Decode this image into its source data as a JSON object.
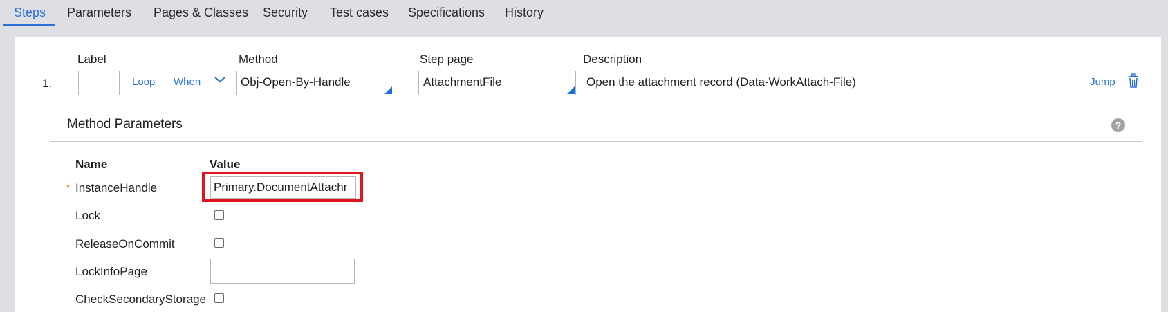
{
  "tabs": [
    {
      "label": "Steps",
      "active": true
    },
    {
      "label": "Parameters"
    },
    {
      "label": "Pages & Classes"
    },
    {
      "label": "Security"
    },
    {
      "label": "Test cases"
    },
    {
      "label": "Specifications"
    },
    {
      "label": "History"
    }
  ],
  "step": {
    "number": "1.",
    "headers": {
      "label": "Label",
      "method": "Method",
      "step_page": "Step page",
      "description": "Description"
    },
    "label_value": "",
    "loop_link": "Loop",
    "when_link": "When",
    "method_value": "Obj-Open-By-Handle",
    "step_page_value": "AttachmentFile",
    "description_value": "Open the attachment record (Data-WorkAttach-File)",
    "jump_link": "Jump"
  },
  "method_parameters": {
    "title": "Method Parameters",
    "help": "?",
    "name_header": "Name",
    "value_header": "Value",
    "required_marker": "*",
    "params": [
      {
        "name": "InstanceHandle",
        "value": "Primary.DocumentAttachr",
        "required": true,
        "type": "text",
        "highlighted": true
      },
      {
        "name": "Lock",
        "type": "checkbox",
        "checked": false
      },
      {
        "name": "ReleaseOnCommit",
        "type": "checkbox",
        "checked": false
      },
      {
        "name": "LockInfoPage",
        "type": "text",
        "value": ""
      },
      {
        "name": "CheckSecondaryStorage",
        "type": "checkbox",
        "checked": false
      }
    ]
  },
  "colors": {
    "accent": "#2b6fd6",
    "highlight": "#e0141e",
    "required": "#d98b3a"
  }
}
